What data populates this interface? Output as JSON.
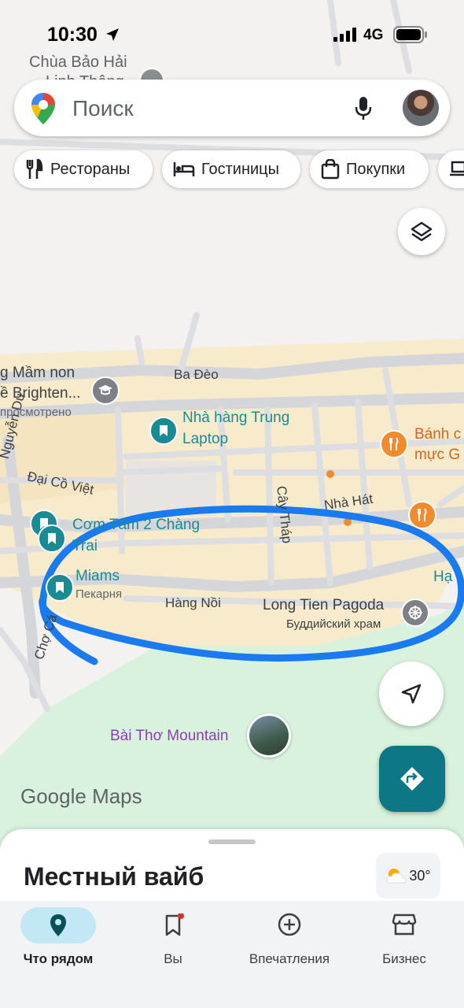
{
  "status_bar": {
    "time": "10:30",
    "network": "4G"
  },
  "search": {
    "placeholder": "Поиск"
  },
  "chips": [
    {
      "label": "Рестораны",
      "icon": "restaurant-icon"
    },
    {
      "label": "Гостиницы",
      "icon": "hotel-icon"
    },
    {
      "label": "Покупки",
      "icon": "shopping-bag-icon"
    },
    {
      "label": "",
      "icon": "laptop-icon"
    }
  ],
  "map": {
    "labels": {
      "chua_bao_hai": "Chùa Bảo Hải",
      "chua_bao_hai_2": "Linh Thông",
      "mam_non": "g Mầm non",
      "brighten": "ề Brighten...",
      "viewed": "просмотрено",
      "nha_hang_trung_1": "Nhà hàng Trung",
      "nha_hang_trung_2": "Laptop",
      "banh_1": "Bánh c",
      "banh_2": "mực G",
      "com_tam_1": "Cơm Tấm 2 Chàng",
      "com_tam_2": "Trai",
      "miams": "Miams",
      "bakery": "Пекарня",
      "long_tien": "Long Tien Pagoda",
      "buddhist": "Буддийский храм",
      "bai_tho": "Bài Thơ Mountain",
      "ha": "Hạ",
      "google_maps": "Google Maps"
    },
    "streets": {
      "ba_deo": "Ba Đèo",
      "nguyen_du": "Nguyễn Du",
      "dai_co_viet": "Đại Cồ Việt",
      "cay_thap": "Cây Tháp",
      "nha_hat": "Nhà Hát",
      "hang_noi": "Hàng Nồi",
      "cho_ca": "Chợ Cá"
    }
  },
  "sheet": {
    "title": "Местный вайб",
    "temperature": "30°"
  },
  "bottom_nav": [
    {
      "label": "Что рядом",
      "icon": "location-pin-icon",
      "active": true
    },
    {
      "label": "Вы",
      "icon": "bookmark-icon",
      "active": false
    },
    {
      "label": "Впечатления",
      "icon": "add-circle-icon",
      "active": false
    },
    {
      "label": "Бизнес",
      "icon": "store-icon",
      "active": false
    }
  ],
  "colors": {
    "accent_teal": "#1a8a93",
    "directions_fab": "#0d7785",
    "annotation_blue": "#1a7bf0",
    "poi_orange": "#f28b2c",
    "park_green": "#d8f2dd",
    "mountain_purple": "#8e3fb0"
  }
}
